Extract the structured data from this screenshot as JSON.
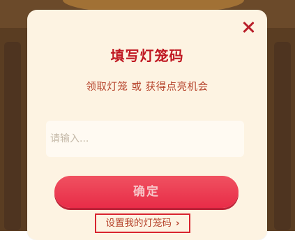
{
  "dialog": {
    "title": "填写灯笼码",
    "subtitle": "领取灯笼 或 获得点亮机会",
    "input": {
      "placeholder": "请输入...",
      "value": ""
    },
    "confirm_label": "确定",
    "set_code_link": "设置我的灯笼码",
    "chevron": "›"
  },
  "colors": {
    "accent": "#c01822",
    "button": "#e82240",
    "dialog_bg": "#fdf3e2"
  }
}
